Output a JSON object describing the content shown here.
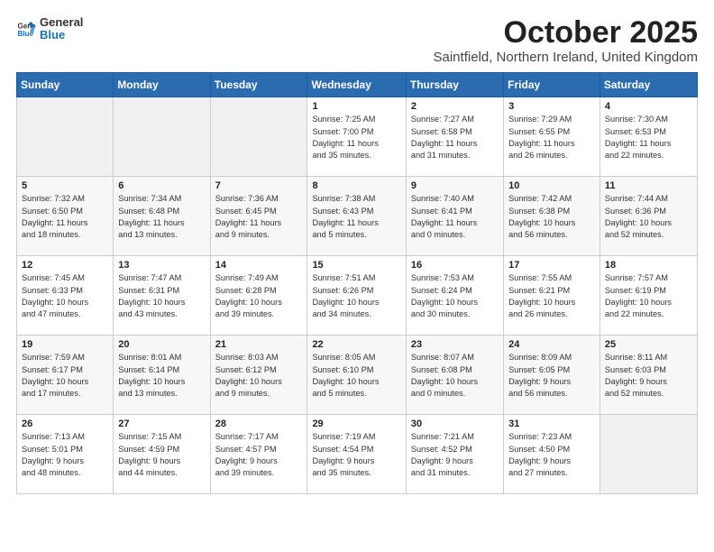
{
  "header": {
    "logo_general": "General",
    "logo_blue": "Blue",
    "title": "October 2025",
    "subtitle": "Saintfield, Northern Ireland, United Kingdom"
  },
  "columns": [
    "Sunday",
    "Monday",
    "Tuesday",
    "Wednesday",
    "Thursday",
    "Friday",
    "Saturday"
  ],
  "weeks": [
    [
      {
        "day": "",
        "info": ""
      },
      {
        "day": "",
        "info": ""
      },
      {
        "day": "",
        "info": ""
      },
      {
        "day": "1",
        "info": "Sunrise: 7:25 AM\nSunset: 7:00 PM\nDaylight: 11 hours\nand 35 minutes."
      },
      {
        "day": "2",
        "info": "Sunrise: 7:27 AM\nSunset: 6:58 PM\nDaylight: 11 hours\nand 31 minutes."
      },
      {
        "day": "3",
        "info": "Sunrise: 7:29 AM\nSunset: 6:55 PM\nDaylight: 11 hours\nand 26 minutes."
      },
      {
        "day": "4",
        "info": "Sunrise: 7:30 AM\nSunset: 6:53 PM\nDaylight: 11 hours\nand 22 minutes."
      }
    ],
    [
      {
        "day": "5",
        "info": "Sunrise: 7:32 AM\nSunset: 6:50 PM\nDaylight: 11 hours\nand 18 minutes."
      },
      {
        "day": "6",
        "info": "Sunrise: 7:34 AM\nSunset: 6:48 PM\nDaylight: 11 hours\nand 13 minutes."
      },
      {
        "day": "7",
        "info": "Sunrise: 7:36 AM\nSunset: 6:45 PM\nDaylight: 11 hours\nand 9 minutes."
      },
      {
        "day": "8",
        "info": "Sunrise: 7:38 AM\nSunset: 6:43 PM\nDaylight: 11 hours\nand 5 minutes."
      },
      {
        "day": "9",
        "info": "Sunrise: 7:40 AM\nSunset: 6:41 PM\nDaylight: 11 hours\nand 0 minutes."
      },
      {
        "day": "10",
        "info": "Sunrise: 7:42 AM\nSunset: 6:38 PM\nDaylight: 10 hours\nand 56 minutes."
      },
      {
        "day": "11",
        "info": "Sunrise: 7:44 AM\nSunset: 6:36 PM\nDaylight: 10 hours\nand 52 minutes."
      }
    ],
    [
      {
        "day": "12",
        "info": "Sunrise: 7:45 AM\nSunset: 6:33 PM\nDaylight: 10 hours\nand 47 minutes."
      },
      {
        "day": "13",
        "info": "Sunrise: 7:47 AM\nSunset: 6:31 PM\nDaylight: 10 hours\nand 43 minutes."
      },
      {
        "day": "14",
        "info": "Sunrise: 7:49 AM\nSunset: 6:28 PM\nDaylight: 10 hours\nand 39 minutes."
      },
      {
        "day": "15",
        "info": "Sunrise: 7:51 AM\nSunset: 6:26 PM\nDaylight: 10 hours\nand 34 minutes."
      },
      {
        "day": "16",
        "info": "Sunrise: 7:53 AM\nSunset: 6:24 PM\nDaylight: 10 hours\nand 30 minutes."
      },
      {
        "day": "17",
        "info": "Sunrise: 7:55 AM\nSunset: 6:21 PM\nDaylight: 10 hours\nand 26 minutes."
      },
      {
        "day": "18",
        "info": "Sunrise: 7:57 AM\nSunset: 6:19 PM\nDaylight: 10 hours\nand 22 minutes."
      }
    ],
    [
      {
        "day": "19",
        "info": "Sunrise: 7:59 AM\nSunset: 6:17 PM\nDaylight: 10 hours\nand 17 minutes."
      },
      {
        "day": "20",
        "info": "Sunrise: 8:01 AM\nSunset: 6:14 PM\nDaylight: 10 hours\nand 13 minutes."
      },
      {
        "day": "21",
        "info": "Sunrise: 8:03 AM\nSunset: 6:12 PM\nDaylight: 10 hours\nand 9 minutes."
      },
      {
        "day": "22",
        "info": "Sunrise: 8:05 AM\nSunset: 6:10 PM\nDaylight: 10 hours\nand 5 minutes."
      },
      {
        "day": "23",
        "info": "Sunrise: 8:07 AM\nSunset: 6:08 PM\nDaylight: 10 hours\nand 0 minutes."
      },
      {
        "day": "24",
        "info": "Sunrise: 8:09 AM\nSunset: 6:05 PM\nDaylight: 9 hours\nand 56 minutes."
      },
      {
        "day": "25",
        "info": "Sunrise: 8:11 AM\nSunset: 6:03 PM\nDaylight: 9 hours\nand 52 minutes."
      }
    ],
    [
      {
        "day": "26",
        "info": "Sunrise: 7:13 AM\nSunset: 5:01 PM\nDaylight: 9 hours\nand 48 minutes."
      },
      {
        "day": "27",
        "info": "Sunrise: 7:15 AM\nSunset: 4:59 PM\nDaylight: 9 hours\nand 44 minutes."
      },
      {
        "day": "28",
        "info": "Sunrise: 7:17 AM\nSunset: 4:57 PM\nDaylight: 9 hours\nand 39 minutes."
      },
      {
        "day": "29",
        "info": "Sunrise: 7:19 AM\nSunset: 4:54 PM\nDaylight: 9 hours\nand 35 minutes."
      },
      {
        "day": "30",
        "info": "Sunrise: 7:21 AM\nSunset: 4:52 PM\nDaylight: 9 hours\nand 31 minutes."
      },
      {
        "day": "31",
        "info": "Sunrise: 7:23 AM\nSunset: 4:50 PM\nDaylight: 9 hours\nand 27 minutes."
      },
      {
        "day": "",
        "info": ""
      }
    ]
  ]
}
